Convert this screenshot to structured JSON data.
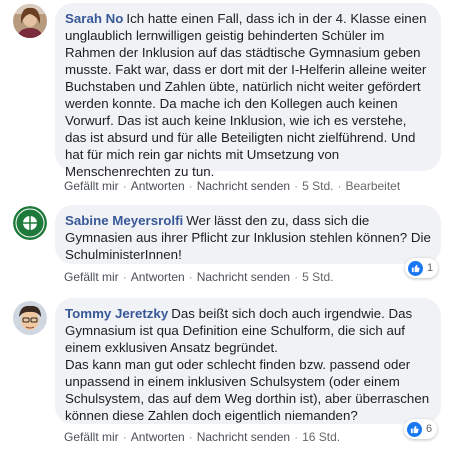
{
  "comments": [
    {
      "author": "Sarah No",
      "text": "Ich hatte einen Fall, dass ich in der 4. Klasse einen unglaublich lernwilligen geistig behinderten Schüler im Rahmen der Inklusion auf das städtische Gymnasium geben musste. Fakt war, dass er dort mit der I-Helferin alleine weiter Buchstaben und Zahlen übte, natürlich nicht weiter gefördert werden konnte. Da mache ich den Kollegen auch keinen Vorwurf. Das ist auch keine Inklusion, wie ich es verstehe, das ist absurd und für alle Beteiligten nicht zielführend. Und hat für mich rein gar nichts mit Umsetzung von Menschenrechten zu tun.",
      "like_label": "Gefällt mir",
      "reply_label": "Antworten",
      "message_label": "Nachricht senden",
      "time": "5 Std.",
      "edited_label": "Bearbeitet"
    },
    {
      "author": "Sabine Meyersrolfi",
      "text": "Wer lässt den zu, dass sich die Gymnasien aus ihrer Pflicht zur Inklusion stehlen können? Die SchulministerInnen!",
      "like_label": "Gefällt mir",
      "reply_label": "Antworten",
      "message_label": "Nachricht senden",
      "time": "5 Std.",
      "reaction_count": "1"
    },
    {
      "author": "Tommy Jeretzky",
      "text": "Das beißt sich doch auch irgendwie. Das Gymnasium ist qua Definition eine Schulform, die sich auf einem exklusiven Ansatz begründet.\nDas kann man gut oder schlecht finden bzw. passend oder unpassend in einem inklusiven Schulsystem (oder einem Schulsystem, das auf dem Weg dorthin ist), aber überraschen können diese Zahlen doch eigentlich niemanden?",
      "like_label": "Gefällt mir",
      "reply_label": "Antworten",
      "message_label": "Nachricht senden",
      "time": "16 Std.",
      "reaction_count": "6"
    }
  ],
  "colors": {
    "bubble": "#f0f2f5",
    "name": "#385898",
    "like_blue": "#1877f2",
    "meta": "#65676b"
  }
}
